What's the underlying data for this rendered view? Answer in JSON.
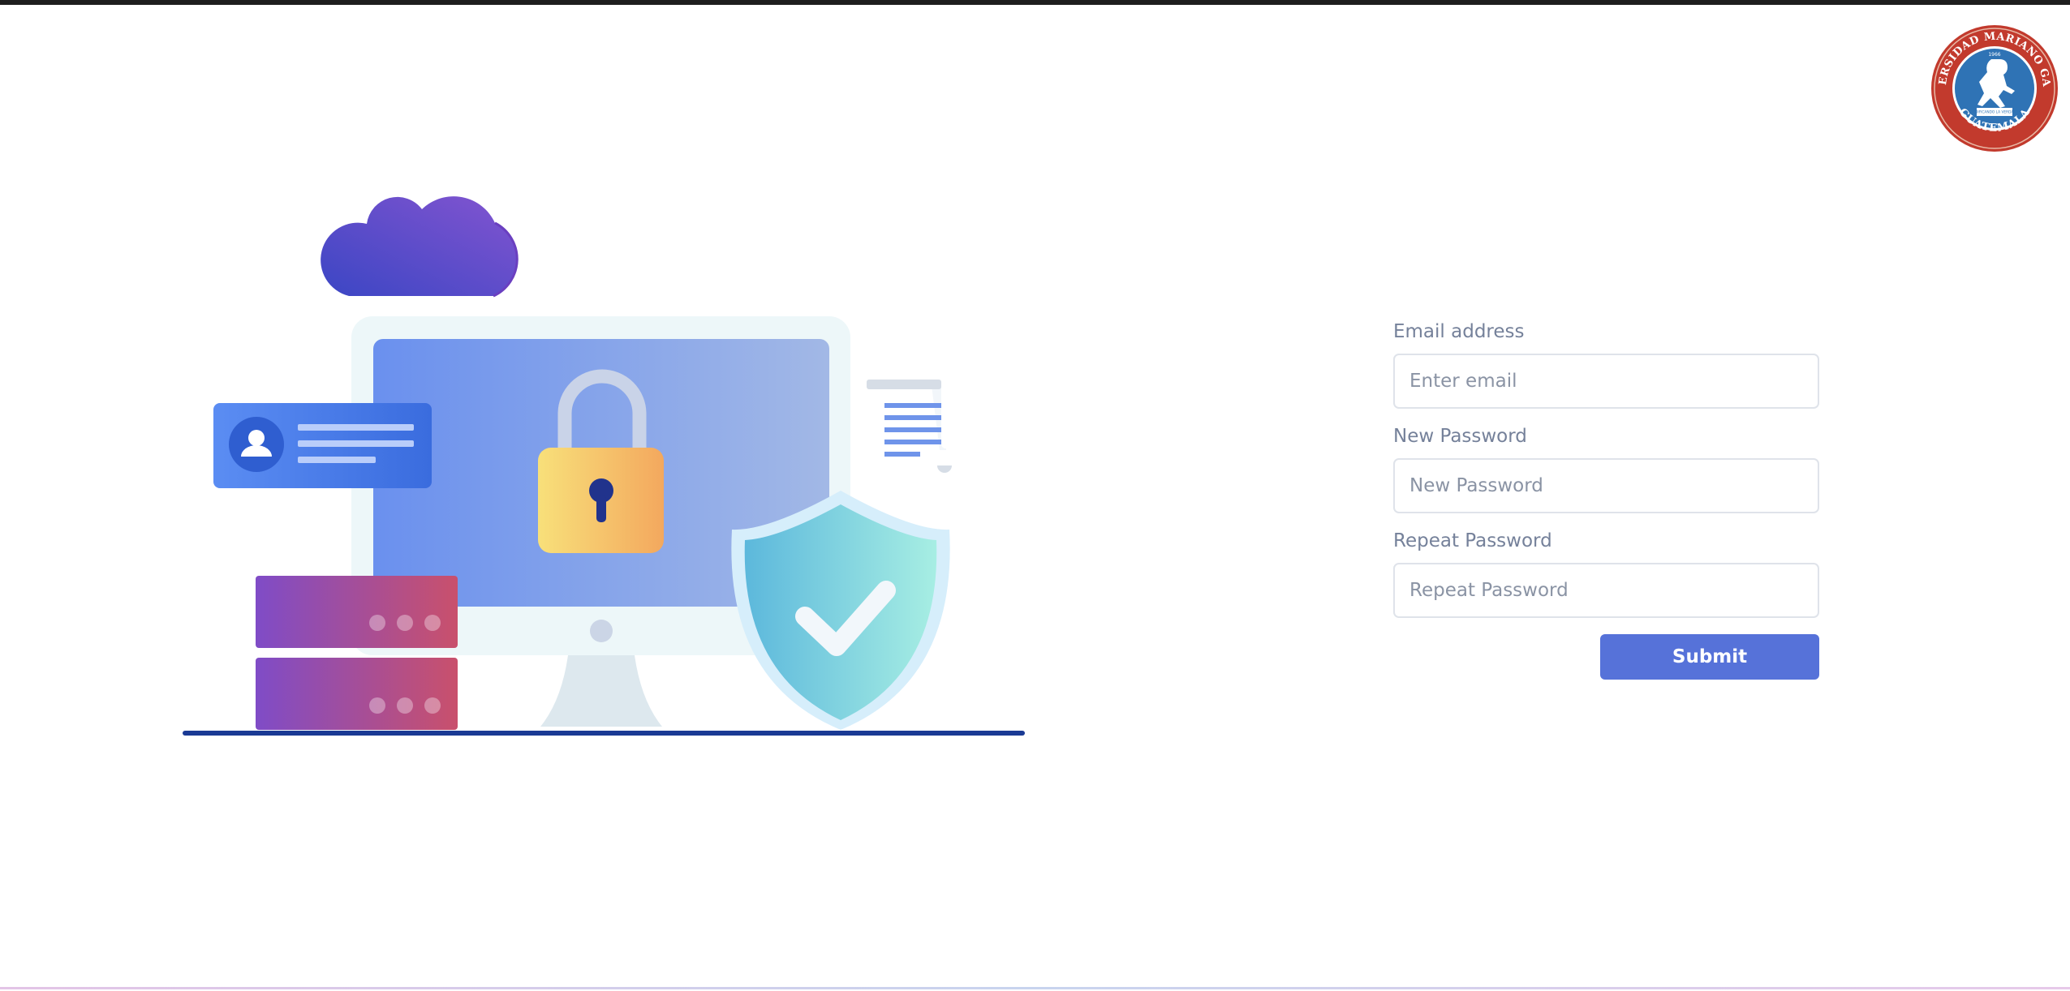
{
  "logo": {
    "text_top": "UNIVERSIDAD MARIANO GALVEZ",
    "text_bottom": "GUATEMALA",
    "year": "1966",
    "ribbon": "EDIFICANDO LA VERDAD",
    "colors": {
      "ring": "#c0392b",
      "center": "#2f73b5"
    }
  },
  "form": {
    "email": {
      "label": "Email address",
      "placeholder": "Enter email",
      "value": ""
    },
    "new_password": {
      "label": "New Password",
      "placeholder": "New Password",
      "value": ""
    },
    "repeat_password": {
      "label": "Repeat Password",
      "placeholder": "Repeat Password",
      "value": ""
    },
    "submit_label": "Submit"
  },
  "illustration": {
    "icons": [
      "cloud-icon",
      "monitor-icon",
      "padlock-icon",
      "user-card-icon",
      "document-icon",
      "server-icon",
      "shield-check-icon"
    ]
  },
  "colors": {
    "accent": "#5672d9",
    "label": "#75819a",
    "input_border": "#dfe3ea",
    "floor_line": "#1a3a94"
  }
}
